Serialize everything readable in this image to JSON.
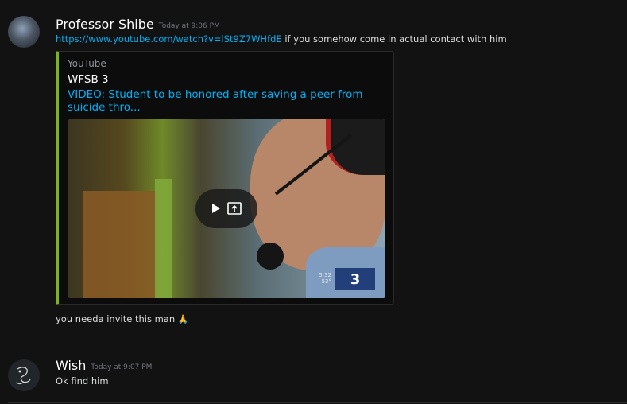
{
  "messages": [
    {
      "author": "Professor Shibe",
      "timestamp": "Today at 9:06 PM",
      "link": "https://www.youtube.com/watch?v=lSt9Z7WHfdE",
      "text_after_link": " if you somehow come in actual contact with him",
      "embed": {
        "provider": "YouTube",
        "author": "WFSB 3",
        "title": "VIDEO: Student to be honored after saving a peer from suicide thro...",
        "accent_color": "#7ab51d",
        "thumbnail": {
          "channel_logo": "3",
          "tv_time": "5:32",
          "tv_temp": "53°",
          "play_icon": "play-icon",
          "open_icon": "open-external-icon"
        }
      },
      "followup_text": "you needa invite this man",
      "followup_emoji": "🙏"
    },
    {
      "author": "Wish",
      "timestamp": "Today at 9:07 PM",
      "text": "Ok find him"
    }
  ],
  "colors": {
    "background": "#121212",
    "link": "#00b0f4",
    "username": "#ffffff",
    "timestamp": "#72767d"
  }
}
